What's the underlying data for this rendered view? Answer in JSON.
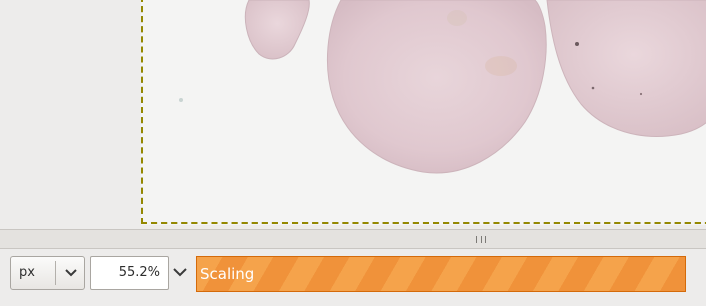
{
  "statusbar": {
    "unit": "px",
    "zoom": "55.2%",
    "progress": {
      "label": "Scaling",
      "fraction": 1.0
    }
  },
  "colors": {
    "progress_fill": "#f5a34b",
    "progress_stripe": "#f0923a",
    "progress_border": "#d46a0a",
    "selection_marching_ants": "#e3d100",
    "canvas_background": "#edeceb"
  },
  "icons": {
    "unit_dropdown": "chevron-down-icon",
    "zoom_dropdown": "chevron-down-icon",
    "scroll_grip": "grip-icon"
  }
}
